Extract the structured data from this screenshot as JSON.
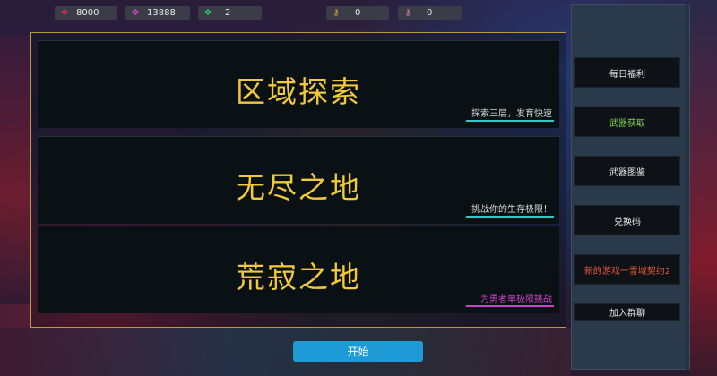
{
  "resources": [
    {
      "icon": "gem-red-icon",
      "glyph": "❖",
      "color": "#d0304a",
      "value": "8000"
    },
    {
      "icon": "gem-pink-icon",
      "glyph": "❖",
      "color": "#d040c8",
      "value": "13888"
    },
    {
      "icon": "gem-green-icon",
      "glyph": "❖",
      "color": "#34c060",
      "value": "2"
    },
    {
      "icon": "key-gold-icon",
      "glyph": "⚷",
      "color": "#d8a040",
      "value": "0"
    },
    {
      "icon": "key-pink-icon",
      "glyph": "⚷",
      "color": "#e07aa0",
      "value": "0"
    }
  ],
  "modes": [
    {
      "title": "区域探索",
      "subtitle": "探索三层，发育快速",
      "line_color": "#33c7c7"
    },
    {
      "title": "无尽之地",
      "subtitle": "挑战你的生存极限！",
      "line_color": "#33c7c7"
    },
    {
      "title": "荒寂之地",
      "subtitle": "为勇者单极限挑战",
      "line_color": "#d040c8",
      "subtitle_color": "#d040c8"
    }
  ],
  "sidebar": {
    "items": [
      {
        "label": "每日福利",
        "color": "#e8e8e8"
      },
      {
        "label": "武器获取",
        "color": "#7cd04a"
      },
      {
        "label": "武器图鉴",
        "color": "#e8e8e8"
      },
      {
        "label": "兑换码",
        "color": "#e8e8e8"
      },
      {
        "label": "新的游戏一雪域契约2",
        "color": "#e05a3a"
      },
      {
        "label": "加入群聊",
        "color": "#e8e8e8"
      }
    ]
  },
  "start_label": "开始",
  "colors": {
    "accent": "#1e9ad6",
    "title_gold": "#f2c93a",
    "frame_gold": "#b79a3e"
  }
}
